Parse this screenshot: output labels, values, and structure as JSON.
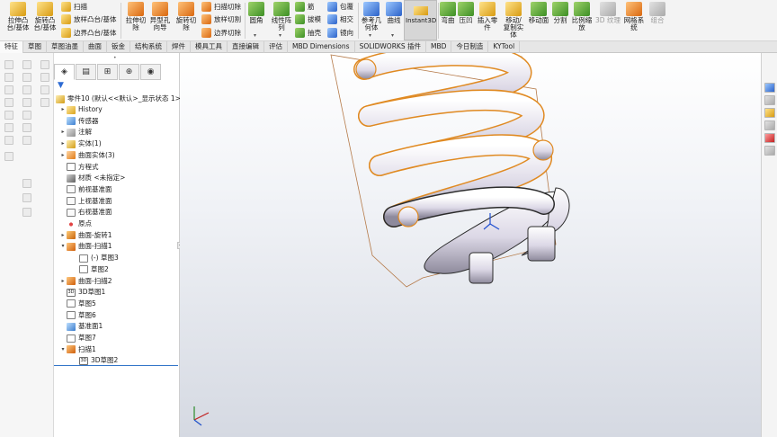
{
  "ribbon": {
    "extrude_boss": "拉伸凸\n台/基体",
    "revolve_boss": "旋转凸\n台/基体",
    "swept_boss": "扫描",
    "loft_boss": "放样凸台/基体",
    "boundary_boss": "边界凸台/基体",
    "extrude_cut": "拉伸切\n除",
    "hole_wizard": "异型孔\n向导",
    "revolve_cut": "旋转切\n除",
    "swept_cut": "扫描切除",
    "loft_cut": "放样切割",
    "boundary_cut": "边界切除",
    "fillet": "圆角",
    "linear_pattern": "线性阵\n列",
    "rib": "筋",
    "draft": "拔模",
    "shell": "抽壳",
    "wrap": "包覆",
    "intersect": "相交",
    "mirror": "镜向",
    "reference_geometry": "参考几\n何体",
    "curves": "曲线",
    "instant3d": "Instant3D",
    "flex": "弯曲",
    "indent": "压凹",
    "insert_part": "插入零\n件",
    "move_copy_body": "移动/\n复制实\n体",
    "move_face": "移动面",
    "split": "分割",
    "scale": "比例缩\n放",
    "texture_3d": "3D 纹理",
    "mesh_system": "网格系\n统",
    "combine": "组合"
  },
  "tabs": [
    {
      "label": "特征",
      "active": true
    },
    {
      "label": "草图",
      "active": false
    },
    {
      "label": "草图油墨",
      "active": false
    },
    {
      "label": "曲面",
      "active": false
    },
    {
      "label": "钣金",
      "active": false
    },
    {
      "label": "结构系统",
      "active": false
    },
    {
      "label": "焊件",
      "active": false
    },
    {
      "label": "模具工具",
      "active": false
    },
    {
      "label": "直接编辑",
      "active": false
    },
    {
      "label": "评估",
      "active": false
    },
    {
      "label": "MBD Dimensions",
      "active": false
    },
    {
      "label": "SOLIDWORKS 插件",
      "active": false
    },
    {
      "label": "MBD",
      "active": false
    },
    {
      "label": "今日制造",
      "active": false
    },
    {
      "label": "KYTool",
      "active": false
    }
  ],
  "feature_tree": {
    "root": "零件10 (默认<<默认>_显示状态 1>)",
    "items": [
      {
        "label": "History",
        "icon": "history-icon",
        "expand": "▸"
      },
      {
        "label": "传感器",
        "icon": "sensor-icon",
        "expand": ""
      },
      {
        "label": "注解",
        "icon": "annotation-icon",
        "expand": "▸"
      },
      {
        "label": "实体(1)",
        "icon": "solid-bodies-icon",
        "expand": "▸"
      },
      {
        "label": "曲面实体(3)",
        "icon": "surface-bodies-icon",
        "expand": "▸"
      },
      {
        "label": "方程式",
        "icon": "equations-icon",
        "expand": ""
      },
      {
        "label": "材质 <未指定>",
        "icon": "material-icon",
        "expand": ""
      },
      {
        "label": "前视基准面",
        "icon": "plane-icon",
        "expand": ""
      },
      {
        "label": "上视基准面",
        "icon": "plane-icon",
        "expand": ""
      },
      {
        "label": "右视基准面",
        "icon": "plane-icon",
        "expand": ""
      },
      {
        "label": "原点",
        "icon": "origin-icon",
        "expand": ""
      },
      {
        "label": "曲面-旋转1",
        "icon": "surface-revolve-icon",
        "expand": "▸"
      },
      {
        "label": "曲面-扫描1",
        "icon": "surface-sweep-icon",
        "expand": "▾"
      },
      {
        "label": "(-) 草图3",
        "icon": "sketch-icon",
        "expand": "",
        "indent": 1
      },
      {
        "label": "草图2",
        "icon": "sketch-icon",
        "expand": "",
        "indent": 1
      },
      {
        "label": "曲面-扫描2",
        "icon": "surface-sweep-icon",
        "expand": "▸"
      },
      {
        "label": "3D草图1",
        "icon": "3d-sketch-icon",
        "expand": ""
      },
      {
        "label": "草图5",
        "icon": "sketch-icon",
        "expand": ""
      },
      {
        "label": "草图6",
        "icon": "sketch-icon",
        "expand": ""
      },
      {
        "label": "基准面1",
        "icon": "reference-plane-icon",
        "expand": ""
      },
      {
        "label": "草图7",
        "icon": "sketch-icon",
        "expand": ""
      },
      {
        "label": "扫描1",
        "icon": "sweep-icon",
        "expand": "▾"
      },
      {
        "label": "3D草图2",
        "icon": "3d-sketch-icon",
        "expand": "",
        "indent": 1
      }
    ]
  },
  "colors": {
    "accent": "#3476c9",
    "selection": "#e68a1e",
    "ribbon_bg": "#f3f3f3",
    "viewport_bottom": "#d5d9e2"
  }
}
